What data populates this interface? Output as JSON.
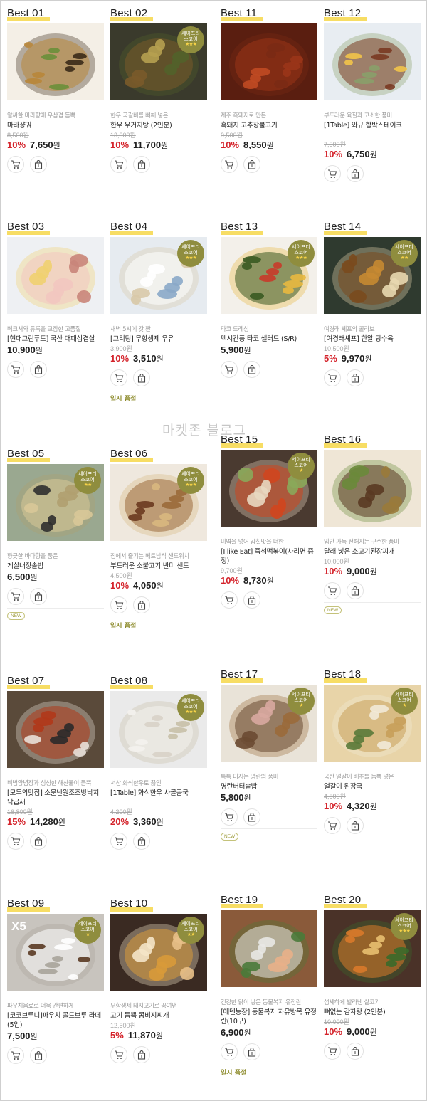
{
  "watermark": "마켓존 블로그",
  "labels": {
    "won": "원",
    "sold_out": "일시 품절",
    "new": "NEW",
    "safety_line1": "세이프티",
    "safety_line2": "스코어"
  },
  "icons": {
    "cart": "cart-icon",
    "bag": "shopping-bag-icon"
  },
  "colors": {
    "accent_yellow": "#f7dd64",
    "discount_red": "#d4222a",
    "badge_olive": "#8f8d3e",
    "star_gold": "#f5d248"
  },
  "products": [
    {
      "best": "Best 01",
      "desc": "알싸한 마라향에 우삼겹 듬뿍",
      "name": "마라샹궈",
      "original": "8,500원",
      "discount": "10%",
      "price": "7,650",
      "badge": false
    },
    {
      "best": "Best 02",
      "desc": "한우 국갈비를 뼈째 넣은",
      "name": "한우 우거지탕 (2인분)",
      "original": "13,000원",
      "discount": "10%",
      "price": "11,700",
      "badge": true,
      "stars": "★★★"
    },
    {
      "best": "Best 11",
      "desc": "제주 흑돼지로 만든",
      "name": "흑돼지 고추장불고기",
      "original": "9,500원",
      "discount": "10%",
      "price": "8,550",
      "badge": false
    },
    {
      "best": "Best 12",
      "desc": "부드러운 육질과 고소한 풍미",
      "name": "[1Table] 와규 함박스테이크",
      "original": "7,500원",
      "discount": "10%",
      "price": "6,750",
      "badge": false
    },
    {
      "best": "Best 03",
      "desc": "버크셔와 듀록을 교잡한 고품질",
      "name": "[현대그린푸드] 국산 대패삼겹살",
      "original": "",
      "discount": "",
      "price": "10,900",
      "badge": false
    },
    {
      "best": "Best 04",
      "desc": "새벽 5시에 갓 짠",
      "name": "[그리팅] 무항생제 우유",
      "original": "3,900원",
      "discount": "10%",
      "price": "3,510",
      "badge": true,
      "stars": "★★★",
      "sold_out": true
    },
    {
      "best": "Best 13",
      "desc": "타코 드레싱",
      "name": "멕시칸풍 타코 샐러드 (S/R)",
      "original": "",
      "discount": "",
      "price": "5,900",
      "badge": true,
      "stars": "★★★"
    },
    {
      "best": "Best 14",
      "desc": "여경래 셰프의 콜라보",
      "name": "[여경래셰프] 한알 탕수육",
      "original": "10,500원",
      "discount": "5%",
      "price": "9,970",
      "badge": true,
      "stars": "★★"
    },
    {
      "best": "Best 05",
      "desc": "향긋한 바다향을 품은",
      "name": "게살내장솥밥",
      "original": "",
      "discount": "",
      "price": "6,500",
      "badge": true,
      "stars": "★★",
      "new": true
    },
    {
      "best": "Best 06",
      "desc": "집에서 즐기는 베트남식 샌드위치",
      "name": "부드러운 소불고기 반미 샌드",
      "original": "4,500원",
      "discount": "10%",
      "price": "4,050",
      "badge": true,
      "stars": "★★★",
      "sold_out": true
    },
    {
      "best": "Best 15",
      "desc": "미역을 넣어 감칠맛을 더한",
      "name": "[I like Eat] 즉석떡볶이(사리면 증정)",
      "original": "9,700원",
      "discount": "10%",
      "price": "8,730",
      "badge": true,
      "stars": "★"
    },
    {
      "best": "Best 16",
      "desc": "입안 가득 전해지는 구수한 풍미",
      "name": "달래 넣은 소고기된장찌개",
      "original": "10,000원",
      "discount": "10%",
      "price": "9,000",
      "badge": false,
      "new": true
    },
    {
      "best": "Best 07",
      "desc": "비법양념장과 싱싱한 해산물이 듬뿍",
      "name": "[모두의맛집] 소문난원조조방낙지 낙곱새",
      "original": "16,800원",
      "discount": "15%",
      "price": "14,280",
      "badge": false
    },
    {
      "best": "Best 08",
      "desc": "서산 화식한우로 끓인",
      "name": "[1Table] 화식한우 사골곰국",
      "original": "4,200원",
      "discount": "20%",
      "price": "3,360",
      "badge": true,
      "stars": "★★★"
    },
    {
      "best": "Best 17",
      "desc": "톡톡 터지는 명란의 풍미",
      "name": "명란버터솥밥",
      "original": "",
      "discount": "",
      "price": "5,800",
      "badge": true,
      "stars": "★",
      "new": true
    },
    {
      "best": "Best 18",
      "desc": "국산 얼갈이 배추를 듬뿍 넣은",
      "name": "얼갈이 된장국",
      "original": "4,800원",
      "discount": "10%",
      "price": "4,320",
      "badge": true,
      "stars": "★"
    },
    {
      "best": "Best 09",
      "desc": "파우치음료로 더욱 간편하게",
      "name": "[코코브루니]파우치 콜드브루 라떼(5입)",
      "original": "",
      "discount": "",
      "price": "7,500",
      "badge": true,
      "stars": "★",
      "x5": "X5"
    },
    {
      "best": "Best 10",
      "desc": "무항생제 돼지고기로 끓여낸",
      "name": "고기 듬뿍 콩비지찌개",
      "original": "12,500원",
      "discount": "5%",
      "price": "11,870",
      "badge": true,
      "stars": "★★"
    },
    {
      "best": "Best 19",
      "desc": "건강한 닭이 낳은 동물복지 유정란",
      "name": "[에덴농장] 동물복지 자유방목 유정란(10구)",
      "original": "",
      "discount": "",
      "price": "6,900",
      "badge": false,
      "sold_out": true
    },
    {
      "best": "Best 20",
      "desc": "섭세하게 발라낸 살코기",
      "name": "뼈없는 감자탕 (2인분)",
      "original": "10,000원",
      "discount": "10%",
      "price": "9,000",
      "badge": true,
      "stars": "★★★"
    }
  ]
}
